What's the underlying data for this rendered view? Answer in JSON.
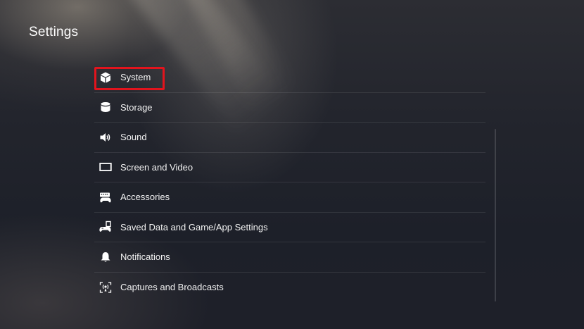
{
  "header": {
    "title": "Settings"
  },
  "menu": {
    "items": [
      {
        "label": "System",
        "icon": "cube-icon",
        "selected": true
      },
      {
        "label": "Storage",
        "icon": "storage-icon"
      },
      {
        "label": "Sound",
        "icon": "speaker-icon"
      },
      {
        "label": "Screen and Video",
        "icon": "screen-icon"
      },
      {
        "label": "Accessories",
        "icon": "accessories-icon"
      },
      {
        "label": "Saved Data and Game/App Settings",
        "icon": "saved-data-icon"
      },
      {
        "label": "Notifications",
        "icon": "bell-icon"
      },
      {
        "label": "Captures and Broadcasts",
        "icon": "broadcast-icon"
      }
    ]
  },
  "colors": {
    "highlight": "#e2141d",
    "text": "#ffffff"
  }
}
